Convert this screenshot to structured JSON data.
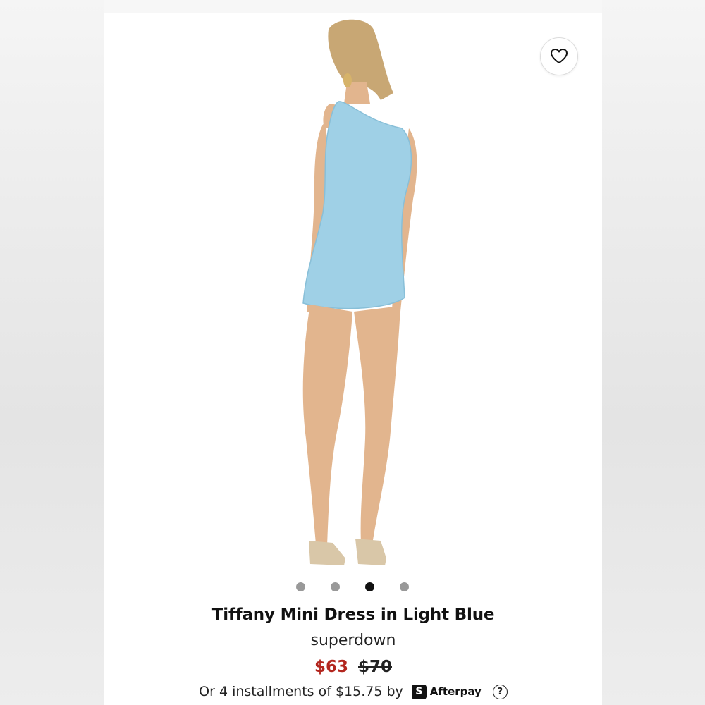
{
  "product": {
    "title": "Tiffany Mini Dress in Light Blue",
    "brand": "superdown",
    "sale_price": "$63",
    "original_price": "$70",
    "installments_text": "Or 4 installments of $15.75 by",
    "afterpay_badge": "S",
    "afterpay_label": "Afterpay",
    "help_label": "?"
  },
  "carousel": {
    "total": 4,
    "active_index": 2
  },
  "icons": {
    "wishlist": "heart-icon",
    "help": "question-icon",
    "afterpay": "afterpay-logo-icon"
  },
  "colors": {
    "sale_price": "#b3261e",
    "dress": "#9fd0e6",
    "active_dot": "#111111",
    "inactive_dot": "#999999"
  }
}
